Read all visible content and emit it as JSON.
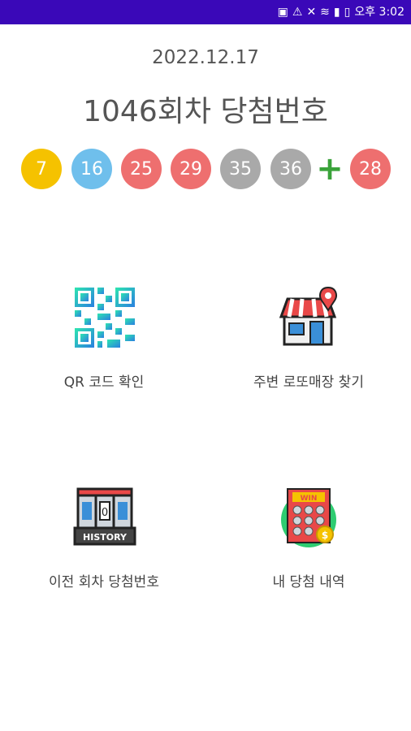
{
  "status_bar": {
    "time": "오후 3:02",
    "icons": [
      "sim-icon",
      "alert-icon",
      "mute-icon",
      "wifi-icon",
      "signal-icon",
      "battery-icon"
    ],
    "color": "#3a08b8"
  },
  "draw": {
    "date": "2022.12.17",
    "title": "1046회차 당첨번호",
    "numbers": [
      {
        "value": "7",
        "color": "#f5c200"
      },
      {
        "value": "16",
        "color": "#6fbfec"
      },
      {
        "value": "25",
        "color": "#ee6f6f"
      },
      {
        "value": "29",
        "color": "#ee6f6f"
      },
      {
        "value": "35",
        "color": "#a9a9a9"
      },
      {
        "value": "36",
        "color": "#a9a9a9"
      }
    ],
    "plus": "+",
    "bonus": {
      "value": "28",
      "color": "#ee6f6f"
    }
  },
  "menu": {
    "qr": {
      "label": "QR 코드 확인",
      "icon": "qr-code-icon"
    },
    "store": {
      "label": "주변 로또매장 찾기",
      "icon": "store-location-icon"
    },
    "history": {
      "label": "이전 회차 당첨번호",
      "icon": "history-icon"
    },
    "my_wins": {
      "label": "내 당첨 내역",
      "icon": "lottery-ticket-icon"
    }
  }
}
